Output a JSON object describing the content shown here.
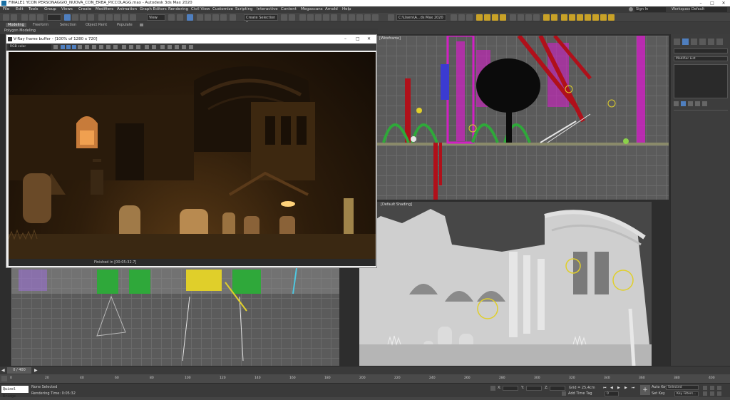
{
  "app": {
    "title": "FINALE1 YCON PERSONAGGIO_NUOVA_CON_ERBA_PICCOLAGG.max - Autodesk 3ds Max 2020",
    "sign_in": "Sign In",
    "workspace_label": "Workspaces:",
    "workspace_value": "Default"
  },
  "menu": [
    "File",
    "Edit",
    "Tools",
    "Group",
    "Views",
    "Create",
    "Modifiers",
    "Animation",
    "Graph Editors",
    "Rendering",
    "Civil View",
    "Customize",
    "Scripting",
    "Interactive",
    "Content",
    "Megascans",
    "Arnold",
    "Help"
  ],
  "toolbar": {
    "view_dropdown": "View",
    "selection_set": "Create Selection Se",
    "path": "C:\\Users\\A...ds Max 2020"
  },
  "ribbon": {
    "tabs": [
      "Modeling",
      "Freeform",
      "Selection",
      "Object Paint",
      "Populate"
    ],
    "active_tab": "Modeling",
    "sub_label": "Polygon Modeling"
  },
  "vfb": {
    "title": "V-Ray frame buffer - [100% of 1280 x 720]",
    "channel": "RGB color",
    "status": "Finished in [00:05:32.7]"
  },
  "viewports": {
    "top_right_label": "[Wireframe]",
    "bottom_right_label": "[Default Shading]"
  },
  "command_panel": {
    "modifier_list": "Modifier List"
  },
  "timeline": {
    "frame_counter": "0 / 400",
    "ticks": [
      "0",
      "20",
      "40",
      "60",
      "80",
      "100",
      "120",
      "140",
      "160",
      "180",
      "200",
      "220",
      "240",
      "260",
      "280",
      "300",
      "320",
      "340",
      "360",
      "380",
      "400"
    ]
  },
  "statusbar": {
    "maxscript_prompt": "Quixel Bridge",
    "selection_status": "None Selected",
    "render_time": "Rendering Time: 0:05:32",
    "x_label": "X:",
    "y_label": "Y:",
    "z_label": "Z:",
    "grid": "Grid = 25,4cm",
    "add_time_tag": "Add Time Tag",
    "auto_key": "Auto Key",
    "set_key": "Set Key",
    "selected": "Selected",
    "key_filters": "Key Filters...",
    "frame": "0"
  },
  "colors": {
    "ui_dark": "#3a3a3a",
    "accent_yellow": "#c9a227",
    "accent_blue": "#4f7fbf",
    "wire_magenta": "#d11fc4",
    "wire_red": "#b0101a",
    "wire_green": "#2fa83a"
  }
}
